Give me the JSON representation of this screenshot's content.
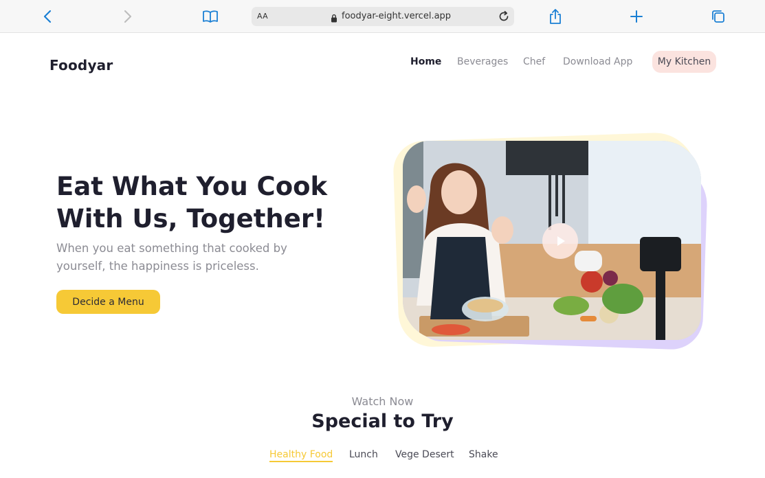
{
  "browser": {
    "url": "foodyar-eight.vercel.app",
    "reader_label": "AA",
    "icons": [
      "back-icon",
      "forward-icon",
      "bookmarks-icon",
      "lock-icon",
      "reload-icon",
      "share-icon",
      "new-tab-icon",
      "tabs-icon"
    ]
  },
  "header": {
    "brand": "Foodyar",
    "nav": [
      {
        "label": "Home",
        "active": true
      },
      {
        "label": "Beverages",
        "active": false
      },
      {
        "label": "Chef",
        "active": false
      },
      {
        "label": "Download App",
        "active": false
      }
    ],
    "cta_label": "My Kitchen"
  },
  "hero": {
    "title_line1": "Eat What You Cook",
    "title_line2": "With Us, Together!",
    "subtitle_line1": "When you eat something that cooked by",
    "subtitle_line2": "yourself, the happiness is priceless.",
    "button_label": "Decide a Menu"
  },
  "section": {
    "eyebrow": "Watch Now",
    "title": "Special to Try",
    "tabs": [
      {
        "label": "Healthy Food",
        "active": true
      },
      {
        "label": "Lunch",
        "active": false
      },
      {
        "label": "Vege Desert",
        "active": false
      },
      {
        "label": "Shake",
        "active": false
      }
    ]
  },
  "colors": {
    "accent": "#f6c936",
    "kitchen_bg": "#fbe3df",
    "text_dark": "#1f1f2e",
    "text_muted": "#8b8b93",
    "ios_blue": "#1a7fd4"
  }
}
